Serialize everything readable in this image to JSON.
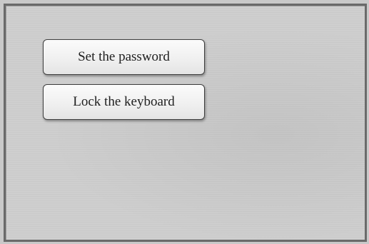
{
  "buttons": {
    "set_password": "Set the password",
    "lock_keyboard": "Lock the keyboard"
  }
}
